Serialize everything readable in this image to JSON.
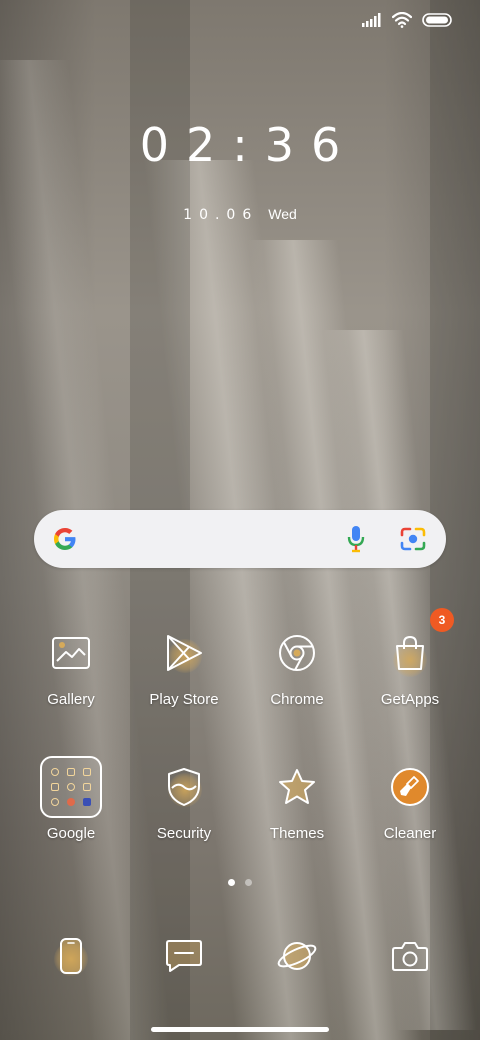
{
  "status": {
    "icons": [
      "signal-icon",
      "wifi-icon",
      "battery-icon"
    ]
  },
  "lockclock": {
    "time": "02:36",
    "date": "10.06",
    "weekday": "Wed"
  },
  "search": {
    "icons": [
      "google-g-icon",
      "microphone-icon",
      "google-lens-icon"
    ]
  },
  "apps": [
    {
      "label": "Gallery",
      "icon": "gallery-icon"
    },
    {
      "label": "Play Store",
      "icon": "play-store-icon"
    },
    {
      "label": "Chrome",
      "icon": "chrome-icon"
    },
    {
      "label": "GetApps",
      "icon": "getapps-icon",
      "badge": "3"
    },
    {
      "label": "Google",
      "icon": "google-folder-icon"
    },
    {
      "label": "Security",
      "icon": "security-shield-icon"
    },
    {
      "label": "Themes",
      "icon": "themes-star-icon"
    },
    {
      "label": "Cleaner",
      "icon": "cleaner-brush-icon"
    }
  ],
  "page_indicator": {
    "pages": 2,
    "current": 1
  },
  "dock": [
    {
      "icon": "phone-icon"
    },
    {
      "icon": "messages-icon"
    },
    {
      "icon": "browser-planet-icon"
    },
    {
      "icon": "camera-icon"
    }
  ],
  "colors": {
    "badge": "#ef5a23",
    "icon_glow": "#d6aa5a",
    "search_bg": "#f1f1f3"
  }
}
